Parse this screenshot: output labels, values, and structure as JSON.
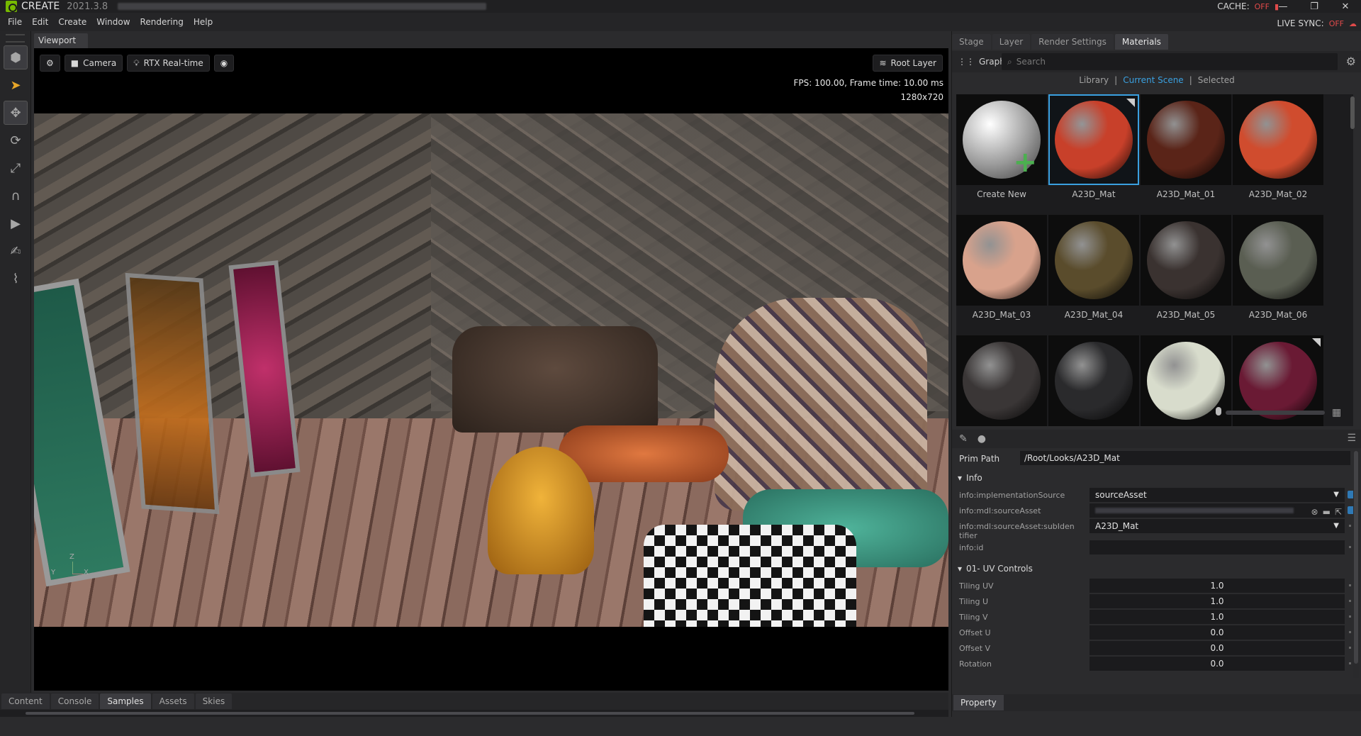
{
  "app": {
    "name": "CREATE",
    "version": "2021.3.8",
    "cache_label": "CACHE:",
    "cache_state": "OFF",
    "live_sync_label": "LIVE SYNC:",
    "live_sync_state": "OFF"
  },
  "menu": [
    "File",
    "Edit",
    "Create",
    "Window",
    "Rendering",
    "Help"
  ],
  "viewport": {
    "tab": "Viewport",
    "camera_label": "Camera",
    "renderer_label": "RTX Real-time",
    "root_layer_label": "Root Layer",
    "fps_text": "FPS: 100.00, Frame time: 10.00 ms",
    "resolution": "1280x720",
    "axis": {
      "z": "Z",
      "y": "Y",
      "x": "X"
    }
  },
  "bottom_tabs": [
    "Content",
    "Console",
    "Samples",
    "Assets",
    "Skies"
  ],
  "bottom_active": "Samples",
  "right_tabs": [
    "Stage",
    "Layer",
    "Render Settings",
    "Materials"
  ],
  "right_active": "Materials",
  "materials": {
    "graph_label": "Graph",
    "search_placeholder": "Search",
    "filters": [
      "Library",
      "Current Scene",
      "Selected"
    ],
    "filter_sep": "|",
    "active_filter": "Current Scene",
    "items": [
      {
        "label": "Create New",
        "color": "#e8e8e8",
        "type": "create"
      },
      {
        "label": "A23D_Mat",
        "color": "#c8402a",
        "selected": true
      },
      {
        "label": "A23D_Mat_01",
        "color": "#5a2418"
      },
      {
        "label": "A23D_Mat_02",
        "color": "#d04c2e"
      },
      {
        "label": "A23D_Mat_03",
        "color": "#d8a28c"
      },
      {
        "label": "A23D_Mat_04",
        "color": "#5a4c2c"
      },
      {
        "label": "A23D_Mat_05",
        "color": "#3a3230"
      },
      {
        "label": "A23D_Mat_06",
        "color": "#5a5e52"
      },
      {
        "label": "",
        "color": "#3a3636"
      },
      {
        "label": "",
        "color": "#2a2a2c"
      },
      {
        "label": "",
        "color": "#d8dccc"
      },
      {
        "label": "",
        "color": "#6a1a34"
      }
    ]
  },
  "property": {
    "prim_path_label": "Prim Path",
    "prim_path_value": "/Root/Looks/A23D_Mat",
    "info_section": "Info",
    "info_rows": [
      {
        "key": "info:implementationSource",
        "value": "sourceAsset",
        "dropdown": true
      },
      {
        "key": "info:mdl:sourceAsset",
        "value": "",
        "path": true
      },
      {
        "key": "info:mdl:sourceAsset:subIden tifier",
        "value": "A23D_Mat",
        "dropdown": true
      },
      {
        "key": "info:id",
        "value": ""
      }
    ],
    "uv_section": "01- UV Controls",
    "uv_rows": [
      {
        "key": "Tiling UV",
        "value": "1.0"
      },
      {
        "key": "Tiling U",
        "value": "1.0"
      },
      {
        "key": "Tiling V",
        "value": "1.0"
      },
      {
        "key": "Offset U",
        "value": "0.0"
      },
      {
        "key": "Offset V",
        "value": "0.0"
      },
      {
        "key": "Rotation",
        "value": "0.0"
      }
    ],
    "footer_tab": "Property"
  }
}
